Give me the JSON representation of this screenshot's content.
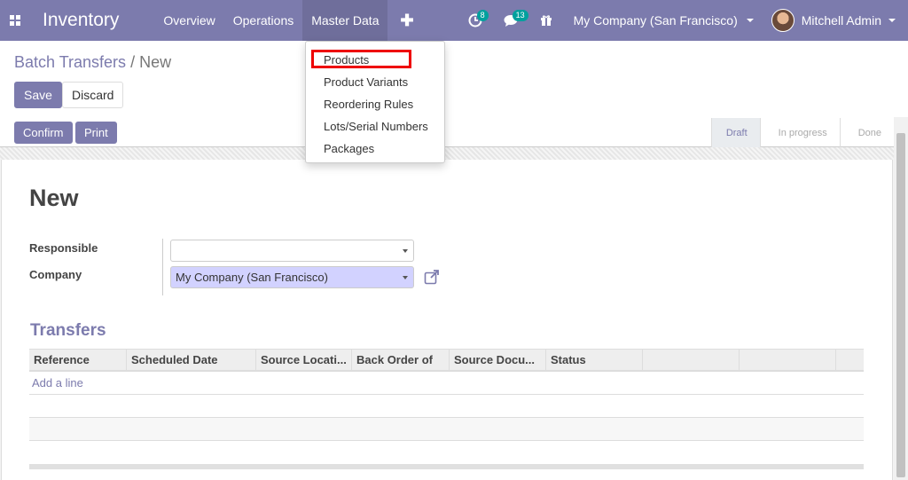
{
  "navbar": {
    "app_name": "Inventory",
    "menu": [
      "Overview",
      "Operations",
      "Master Data"
    ],
    "plus": "✚",
    "activity_count": "8",
    "message_count": "13",
    "company": "My Company (San Francisco)",
    "user": "Mitchell Admin",
    "colors": {
      "primary": "#7c7bad",
      "badge": "#00a09d"
    }
  },
  "breadcrumb": {
    "parent": "Batch Transfers",
    "separator": "/",
    "current": "New"
  },
  "buttons": {
    "save": "Save",
    "discard": "Discard",
    "confirm": "Confirm",
    "print": "Print"
  },
  "status": {
    "stages": [
      "Draft",
      "In progress",
      "Done"
    ],
    "current": "Draft"
  },
  "form": {
    "title": "New",
    "responsible_label": "Responsible",
    "responsible_value": "",
    "company_label": "Company",
    "company_value": "My Company (San Francisco)"
  },
  "transfers": {
    "section_title": "Transfers",
    "columns": [
      "Reference",
      "Scheduled Date",
      "Source Locati...",
      "Back Order of",
      "Source Docu...",
      "Status",
      "",
      "",
      ""
    ],
    "add_line": "Add a line"
  },
  "dropdown": {
    "items": [
      "Products",
      "Product Variants",
      "Reordering Rules",
      "Lots/Serial Numbers",
      "Packages"
    ]
  }
}
